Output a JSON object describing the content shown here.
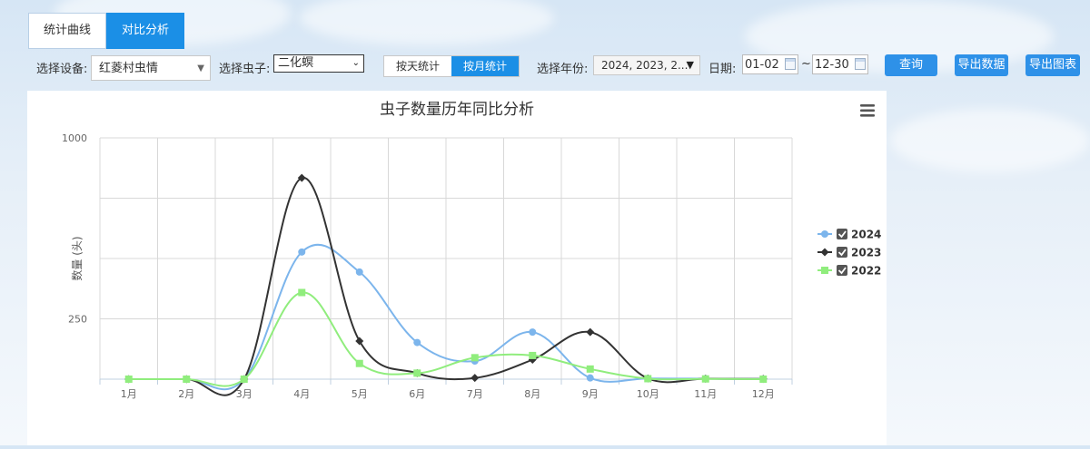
{
  "tabs": [
    {
      "label": "统计曲线",
      "active": false
    },
    {
      "label": "对比分析",
      "active": true
    }
  ],
  "filters": {
    "device_label": "选择设备:",
    "device_value": "红菱村虫情",
    "pest_label": "选择虫子:",
    "pest_value": "二化螟",
    "mode_options": [
      {
        "label": "按天统计",
        "active": false
      },
      {
        "label": "按月统计",
        "active": true
      }
    ],
    "year_label": "选择年份:",
    "year_value": "2024, 2023, 2...",
    "date_label": "日期:",
    "date_from": "01-02",
    "date_sep": "~",
    "date_to": "12-30"
  },
  "buttons": {
    "query": "查询",
    "export_data": "导出数据",
    "export_chart": "导出图表"
  },
  "chart_data": {
    "type": "line",
    "title": "虫子数量历年同比分析",
    "ylabel": "数量 (头)",
    "xlabel": "",
    "categories": [
      "1月",
      "2月",
      "3月",
      "4月",
      "5月",
      "6月",
      "7月",
      "8月",
      "9月",
      "10月",
      "11月",
      "12月"
    ],
    "ylim": [
      0,
      1000
    ],
    "yticks": [
      {
        "value": 1000,
        "label": "1000"
      },
      {
        "value": 750,
        "label": ""
      },
      {
        "value": 500,
        "label": ""
      },
      {
        "value": 250,
        "label": "250"
      }
    ],
    "grid": true,
    "legend": "right",
    "series": [
      {
        "name": "2024",
        "color": "#7cb5ec",
        "marker": "circle",
        "checked": true,
        "values": [
          0,
          0,
          0,
          527,
          444,
          152,
          75,
          195,
          5,
          3,
          2,
          1
        ]
      },
      {
        "name": "2023",
        "color": "#333333",
        "marker": "diamond",
        "checked": true,
        "values": [
          0,
          0,
          0,
          834,
          158,
          25,
          5,
          81,
          195,
          3,
          2,
          1
        ]
      },
      {
        "name": "2022",
        "color": "#90ed7d",
        "marker": "square",
        "checked": true,
        "values": [
          0,
          0,
          0,
          359,
          65,
          25,
          89,
          98,
          42,
          2,
          1,
          0
        ]
      }
    ]
  }
}
